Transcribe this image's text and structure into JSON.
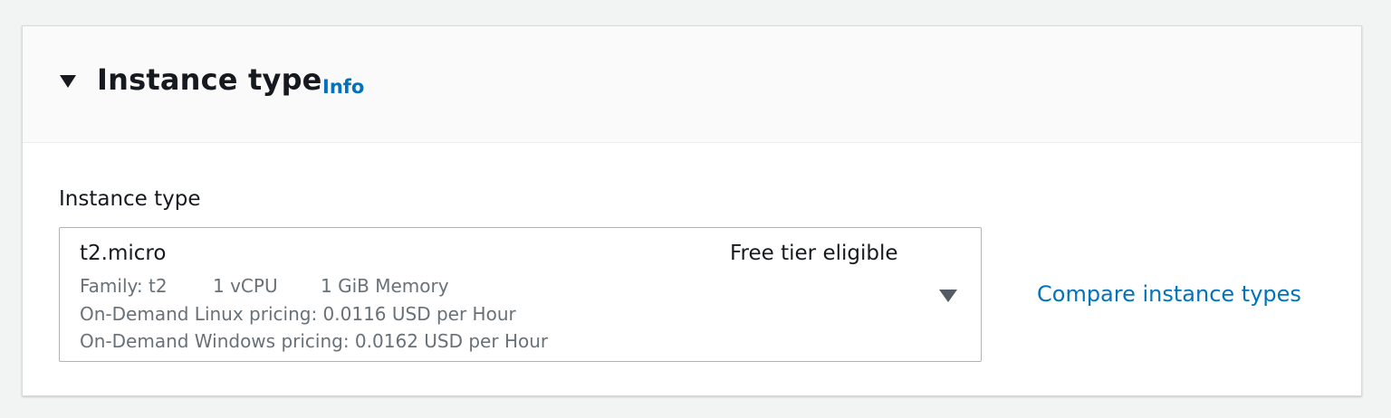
{
  "section": {
    "title": "Instance type",
    "info_link": "Info",
    "expanded_icon": "caret-down-icon"
  },
  "field": {
    "label": "Instance type",
    "selected": {
      "name": "t2.micro",
      "badge": "Free tier eligible",
      "family": "Family: t2",
      "vcpu": "1 vCPU",
      "memory": "1 GiB Memory",
      "linux_pricing": "On-Demand Linux pricing: 0.0116 USD per Hour",
      "windows_pricing": "On-Demand Windows pricing: 0.0162 USD per Hour"
    },
    "dropdown_icon": "caret-down-icon"
  },
  "compare_link": "Compare instance types",
  "colors": {
    "link": "#0073bb",
    "text": "#16191f",
    "secondary_text": "#687078",
    "header_bg": "#fafafa",
    "page_bg": "#f2f3f3",
    "border": "#aab7b8"
  }
}
